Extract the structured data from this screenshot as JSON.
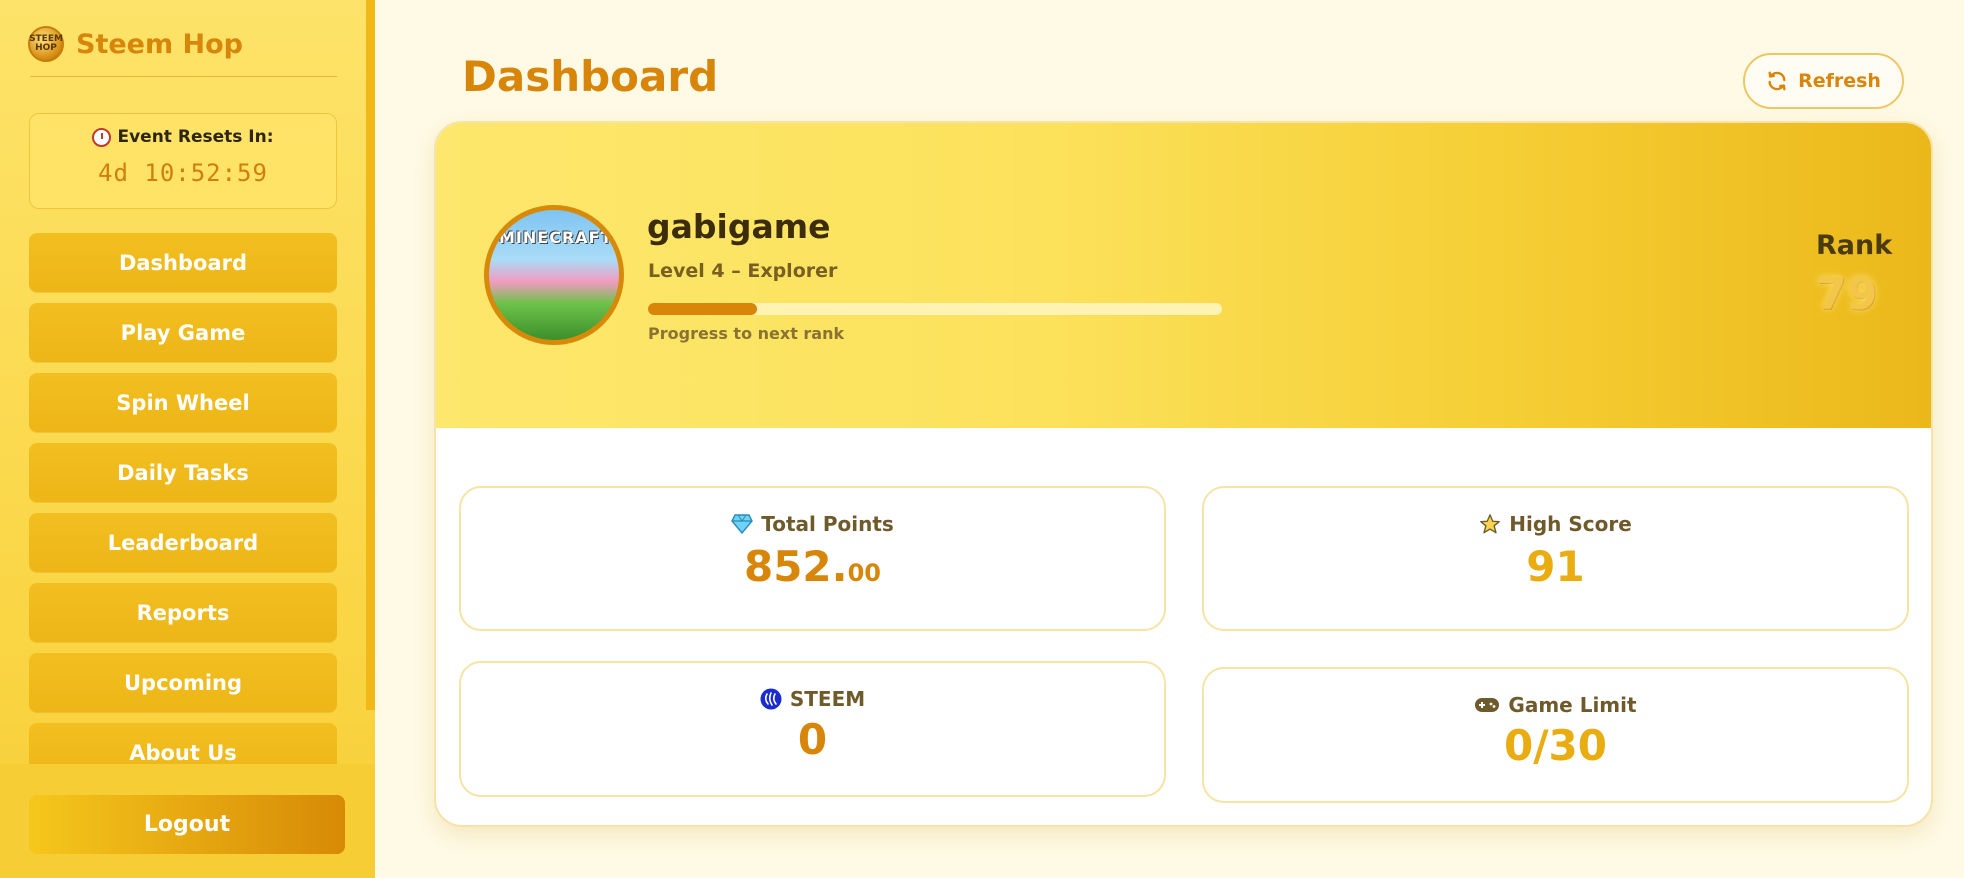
{
  "brand": {
    "name": "Steem Hop",
    "logo_text": "STEEM HOP"
  },
  "event": {
    "label": "Event Resets In:",
    "timer": "4d 10:52:59"
  },
  "nav": {
    "items": [
      {
        "label": "Dashboard"
      },
      {
        "label": "Play Game"
      },
      {
        "label": "Spin Wheel"
      },
      {
        "label": "Daily Tasks"
      },
      {
        "label": "Leaderboard"
      },
      {
        "label": "Reports"
      },
      {
        "label": "Upcoming"
      },
      {
        "label": "About Us"
      }
    ],
    "logout_label": "Logout"
  },
  "header": {
    "title": "Dashboard",
    "refresh_label": "Refresh"
  },
  "profile": {
    "avatar_text": "MINECRAFT",
    "username": "gabigame",
    "level": "Level 4 – Explorer",
    "progress_fraction": 0.19,
    "progress_label": "Progress to next rank",
    "rank_label": "Rank",
    "rank_value": "79"
  },
  "stats": {
    "total_points": {
      "label": "Total Points",
      "value_int": "852.",
      "value_dec": "00",
      "icon": "diamond-icon"
    },
    "high_score": {
      "label": "High Score",
      "value": "91",
      "icon": "star-icon"
    },
    "steem": {
      "label": "STEEM",
      "value": "0",
      "icon": "steem-icon"
    },
    "game_limit": {
      "label": "Game Limit",
      "value": "0/30",
      "icon": "gamepad-icon"
    }
  },
  "colors": {
    "accent": "#d8860a",
    "sidebar_button": "#f0ba1b",
    "hero_start": "#fde76c",
    "hero_end": "#ebb81a"
  }
}
